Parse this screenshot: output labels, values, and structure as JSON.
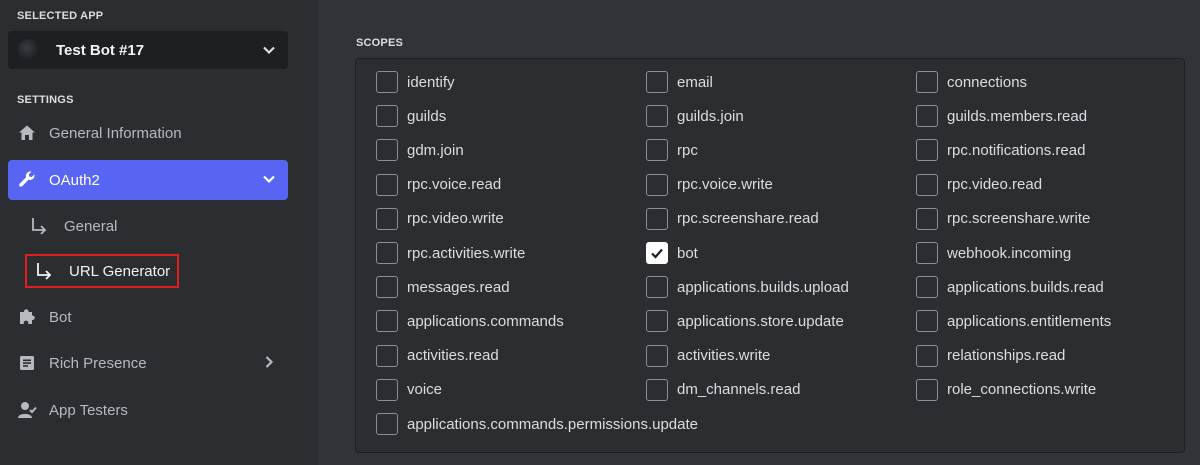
{
  "sidebar": {
    "selected_app_label": "SELECTED APP",
    "app_name": "Test Bot #17",
    "settings_label": "SETTINGS",
    "items": [
      {
        "label": "General Information",
        "icon": "home-icon"
      },
      {
        "label": "OAuth2",
        "icon": "wrench-icon",
        "active": true
      },
      {
        "label": "General",
        "icon": "sub-arrow-icon"
      },
      {
        "label": "URL Generator",
        "icon": "sub-arrow-icon",
        "highlighted": true
      },
      {
        "label": "Bot",
        "icon": "puzzle-icon"
      },
      {
        "label": "Rich Presence",
        "icon": "document-icon"
      },
      {
        "label": "App Testers",
        "icon": "user-icon"
      }
    ]
  },
  "scopes": {
    "title": "SCOPES",
    "columns": [
      [
        "identify",
        "guilds",
        "gdm.join",
        "rpc.voice.read",
        "rpc.video.write",
        "rpc.activities.write",
        "messages.read",
        "applications.commands",
        "activities.read",
        "voice",
        "applications.commands.permissions.update"
      ],
      [
        "email",
        "guilds.join",
        "rpc",
        "rpc.voice.write",
        "rpc.screenshare.read",
        "bot",
        "applications.builds.upload",
        "applications.store.update",
        "activities.write",
        "dm_channels.read"
      ],
      [
        "connections",
        "guilds.members.read",
        "rpc.notifications.read",
        "rpc.video.read",
        "rpc.screenshare.write",
        "webhook.incoming",
        "applications.builds.read",
        "applications.entitlements",
        "relationships.read",
        "role_connections.write"
      ]
    ],
    "checked": [
      "bot"
    ]
  },
  "colors": {
    "accent": "#5865f2",
    "sidebar_bg": "#2b2d31",
    "page_bg": "#313338",
    "highlight_border": "#e01e1e"
  }
}
